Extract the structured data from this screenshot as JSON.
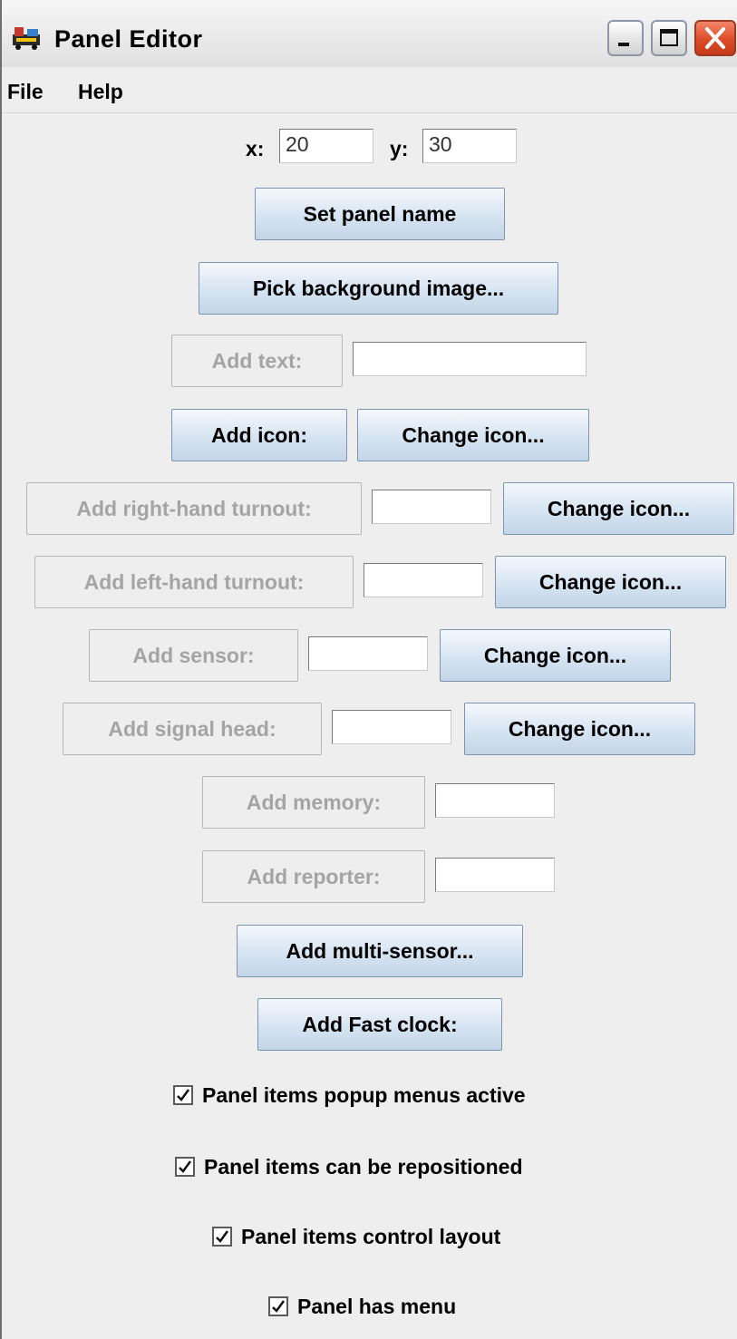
{
  "window": {
    "title": "Panel Editor"
  },
  "menu": {
    "items": [
      "File",
      "Help"
    ]
  },
  "position": {
    "x_label": "x:",
    "x_value": "20",
    "y_label": "y:",
    "y_value": "30"
  },
  "buttons": {
    "set_panel_name": "Set panel name",
    "pick_background": "Pick background image...",
    "add_text": "Add text:",
    "add_icon": "Add icon:",
    "change_icon": "Change icon...",
    "add_right_turnout": "Add right-hand turnout:",
    "add_left_turnout": "Add left-hand turnout:",
    "add_sensor": "Add sensor:",
    "add_signal_head": "Add signal head:",
    "add_memory": "Add memory:",
    "add_reporter": "Add reporter:",
    "add_multi_sensor": "Add multi-sensor...",
    "add_fast_clock": "Add Fast clock:"
  },
  "checkboxes": [
    {
      "label": "Panel items popup menus active",
      "checked": true
    },
    {
      "label": "Panel items can be repositioned",
      "checked": true
    },
    {
      "label": "Panel items control layout",
      "checked": true
    },
    {
      "label": "Panel has menu",
      "checked": true
    }
  ],
  "colors": {
    "button_blue": "#d6e4f2",
    "close_red": "#de4b26",
    "disabled_text": "#a4a4a4"
  }
}
